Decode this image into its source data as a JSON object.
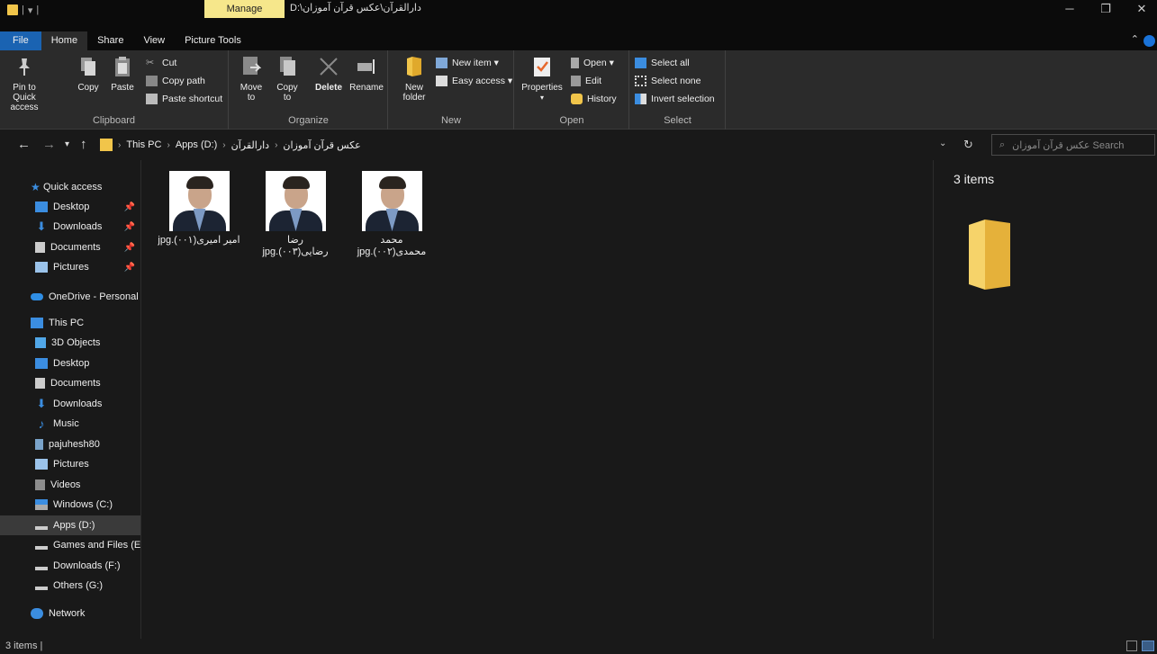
{
  "titlebar": {
    "manage": "Manage",
    "path": "D:\\دارالقرآن\\عکس قرآن آموزان",
    "minimize": "─",
    "restore": "❐",
    "close": "✕"
  },
  "tabs": {
    "file": "File",
    "home": "Home",
    "share": "Share",
    "view": "View",
    "picture_tools": "Picture Tools"
  },
  "ribbon": {
    "clipboard": {
      "label": "Clipboard",
      "pin": "Pin to Quick access",
      "copy": "Copy",
      "paste": "Paste",
      "cut": "Cut",
      "copy_path": "Copy path",
      "paste_shortcut": "Paste shortcut"
    },
    "organize": {
      "label": "Organize",
      "move_to": "Move to",
      "copy_to": "Copy to",
      "delete": "Delete",
      "rename": "Rename"
    },
    "new": {
      "label": "New",
      "new_folder": "New folder",
      "new_item": "New item ▾",
      "easy_access": "Easy access ▾"
    },
    "open": {
      "label": "Open",
      "properties": "Properties",
      "open": "Open ▾",
      "edit": "Edit",
      "history": "History"
    },
    "select": {
      "label": "Select",
      "select_all": "Select all",
      "select_none": "Select none",
      "invert": "Invert selection"
    }
  },
  "address": {
    "crumbs": [
      "This PC",
      "Apps (D:)",
      "دارالقرآن",
      "عکس قرآن آموزان"
    ],
    "search_placeholder": "Search عکس قرآن آموزان"
  },
  "sidebar": {
    "quick_access": "Quick access",
    "qa_items": [
      "Desktop",
      "Downloads",
      "Documents",
      "Pictures"
    ],
    "onedrive": "OneDrive - Personal",
    "this_pc": "This PC",
    "pc_items": [
      "3D Objects",
      "Desktop",
      "Documents",
      "Downloads",
      "Music",
      "pajuhesh80",
      "Pictures",
      "Videos",
      "Windows (C:)",
      "Apps (D:)",
      "Games and Files (E:)",
      "Downloads (F:)",
      "Others (G:)"
    ],
    "network": "Network"
  },
  "files": [
    {
      "line1": "امیر امیری(۰۰۱).jpg",
      "line2": ""
    },
    {
      "line1": "رضا",
      "line2": "رضایی(۰۰۳).jpg"
    },
    {
      "line1": "محمد",
      "line2": "محمدی(۰۰۲).jpg"
    }
  ],
  "preview": {
    "count": "3 items"
  },
  "status": {
    "count": "3 items  |"
  },
  "colors": {
    "accent": "#1a63b2",
    "manage": "#f6e78b",
    "folder": "#f1c54a"
  }
}
